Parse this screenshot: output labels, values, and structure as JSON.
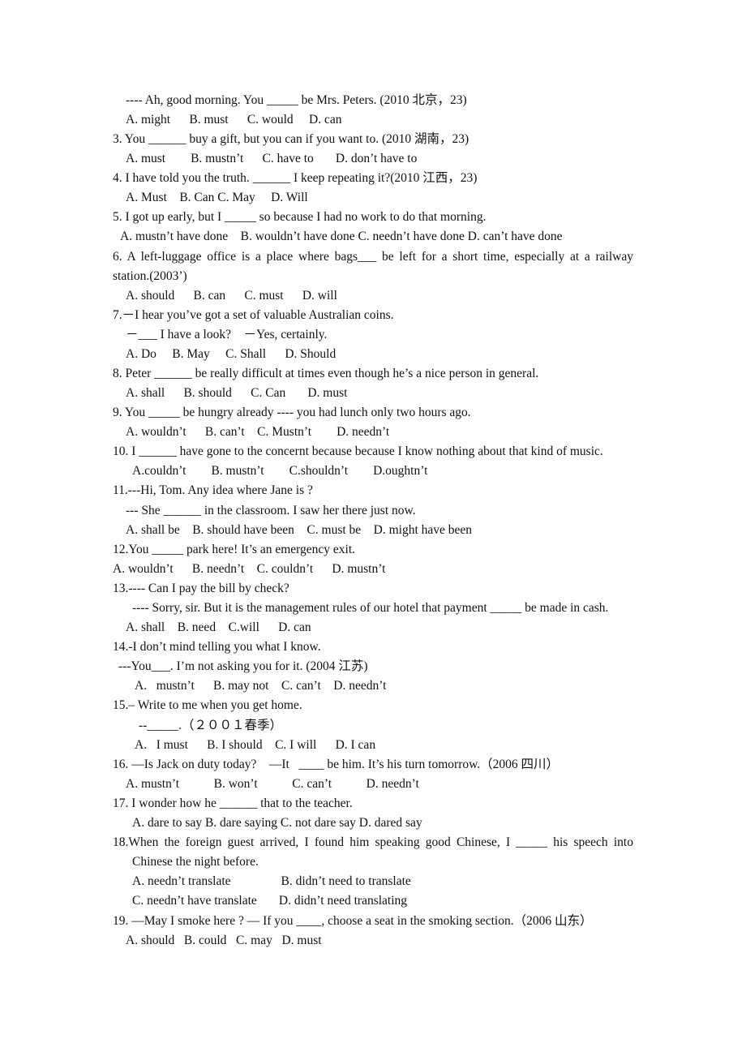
{
  "document": {
    "lines": [
      "---- Ah, good morning. You _____ be Mrs. Peters. (2010 北京，23)",
      "A. might      B. must      C. would     D. can",
      "3. You ______ buy a gift, but you can if you want to. (2010 湖南，23)",
      "A. must        B. mustn’t      C. have to       D. don’t have to",
      "4. I have told you the truth. ______ I keep repeating it?(2010 江西，23)",
      "A. Must    B. Can C. May     D. Will",
      "5. I got up early, but I _____ so because I had no work to do that morning.",
      "A. mustn’t have done    B. wouldn’t have done C. needn’t have done D. can’t have done",
      "6. A left-luggage office is a place where bags___ be left for a short time, especially at a railway",
      "station.(2003’)",
      "A. should      B. can      C. must      D. will",
      "7.－I hear you’ve got a set of valuable Australian coins.",
      "－___ I have a look?    －Yes, certainly.",
      "A. Do     B. May     C. Shall      D. Should",
      "8. Peter ______ be really difficult at times even though he’s a nice person in general.",
      "A. shall      B. should      C. Can       D. must",
      "9. You _____ be hungry already ---- you had lunch only two hours ago.",
      "A. wouldn’t      B. can’t    C. Mustn’t        D. needn’t",
      "10. I ______ have gone to the concernt because because I know nothing about that kind of music.",
      "A.couldn’t        B. mustn’t        C.shouldn’t        D.oughtn’t",
      "11.---Hi, Tom. Any idea where Jane is ?",
      "--- She ______ in the classroom. I saw her there just now.",
      "A. shall be    B. should have been    C. must be    D. might have been",
      "12.You _____ park here! It’s an emergency exit.",
      "A. wouldn’t      B. needn’t    C. couldn’t      D. mustn’t",
      "13.---- Can I pay the bill by check?",
      "---- Sorry, sir. But it is the management rules of our hotel that payment _____ be made in cash.",
      "A. shall    B. need    C.will      D. can",
      "14.-I don’t mind telling you what I know.",
      "---You___. I’m not asking you for it. (2004 江苏)",
      "A.   mustn’t      B. may not    C. can’t    D. needn’t",
      "15.– Write to me when you get home.",
      "--_____.（２００１春季）",
      "A.   I must      B. I should    C. I will      D. I can",
      "16. —Is Jack on duty today?    —It   ____ be him. It’s his turn tomorrow.（2006 四川）",
      "A. mustn’t           B. won’t           C. can’t           D. needn’t",
      "17. I wonder how he ______ that to the teacher.",
      "A. dare to say B. dare saying C. not dare say D. dared say",
      "18.When the foreign guest arrived, I found him speaking good Chinese, I _____ his speech into",
      "Chinese the night before.",
      "A. needn’t translate                B. didn’t need to translate",
      "C. needn’t have translate       D. didn’t need translating",
      "19. —May I smoke here ? — If you ____, choose a seat in the smoking section.（2006 山东）",
      "A. should   B. could   C. may   D. must"
    ]
  }
}
